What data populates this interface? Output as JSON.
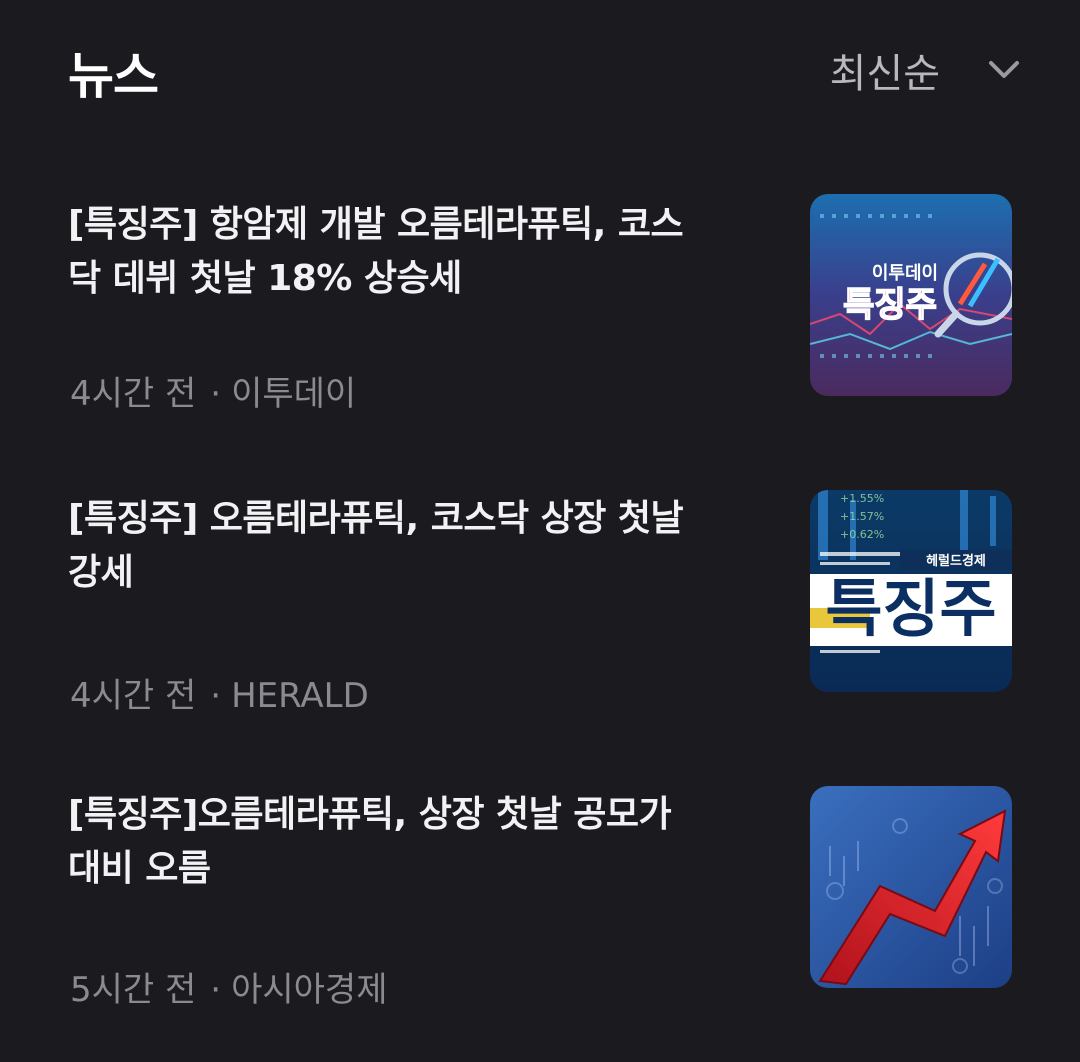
{
  "header": {
    "title": "뉴스",
    "sort_label": "최신순"
  },
  "news": [
    {
      "title": "[특징주] 항암제 개발 오름테라퓨틱, 코스닥 데뷔 첫날 18% 상승세",
      "time": "4시간 전",
      "source": "이투데이",
      "thumb_text_top": "이투데이",
      "thumb_text_main": "특징주"
    },
    {
      "title": "[특징주] 오름테라퓨틱, 코스닥 상장 첫날 강세",
      "time": "4시간 전",
      "source": "HERALD",
      "thumb_text_top": "헤럴드경제",
      "thumb_text_main": "특징주"
    },
    {
      "title": "[특징주]오름테라퓨틱, 상장 첫날 공모가 대비 오름",
      "time": "5시간 전",
      "source": "아시아경제"
    }
  ],
  "colors": {
    "background": "#1b1a1f",
    "title_text": "#f2f2f4",
    "meta_text": "#8a8a90"
  }
}
